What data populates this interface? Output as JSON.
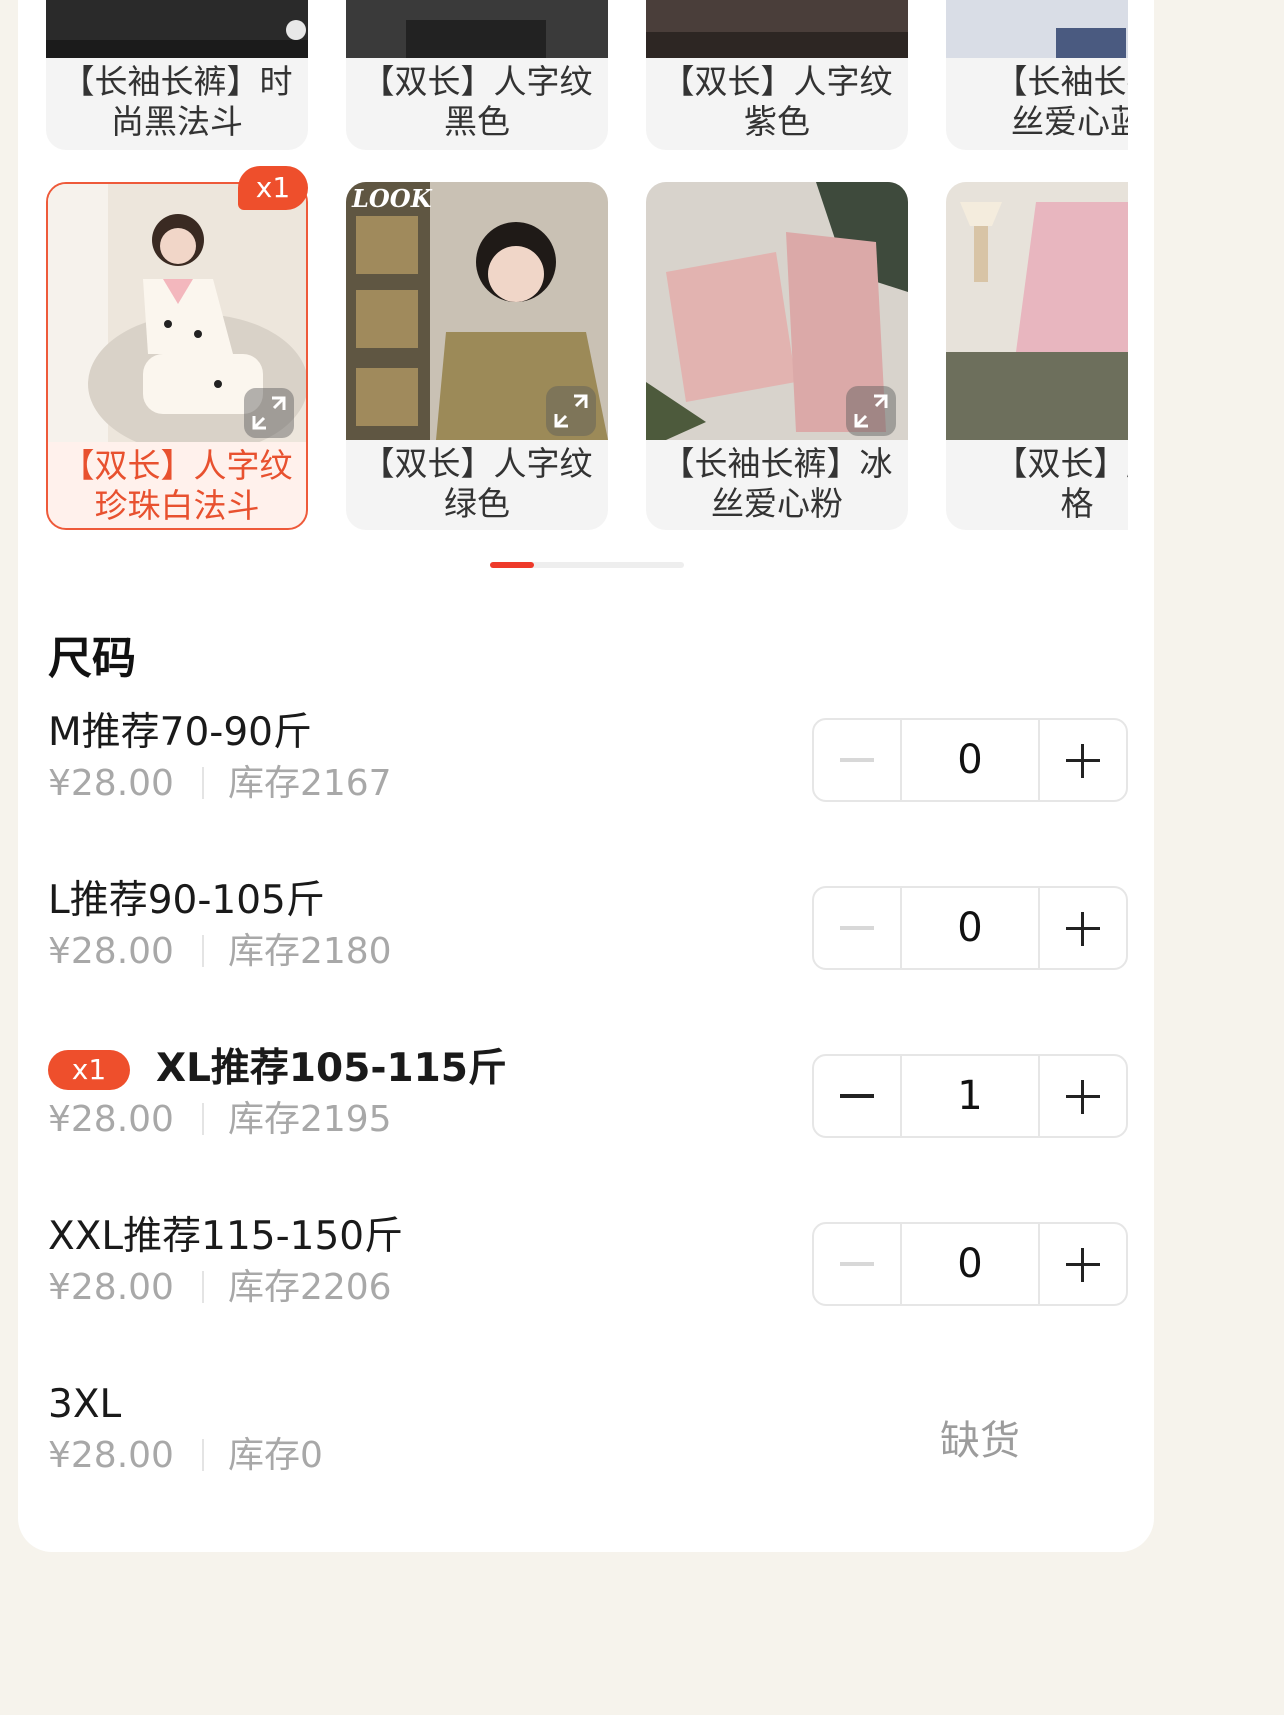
{
  "variants": {
    "row1": [
      {
        "label": "【长袖长裤】时\n尚黑法斗"
      },
      {
        "label": "【双长】人字纹\n黑色"
      },
      {
        "label": "【双长】人字纹\n紫色"
      },
      {
        "label": "【长袖长裤\n丝爱心蓝"
      }
    ],
    "row2": [
      {
        "label": "【双长】人字纹\n珍珠白法斗",
        "badge": "x1"
      },
      {
        "label": "【双长】人字纹\n绿色",
        "thumb_text": "LOOK"
      },
      {
        "label": "【长袖长裤】冰\n丝爱心粉"
      },
      {
        "label": "【双长】胭\n格"
      }
    ]
  },
  "sizes": {
    "title": "尺码",
    "items": [
      {
        "name": "M推荐70-90斤",
        "price": "¥28.00",
        "stock": "库存2167",
        "qty": "0"
      },
      {
        "name": "L推荐90-105斤",
        "price": "¥28.00",
        "stock": "库存2180",
        "qty": "0"
      },
      {
        "name": "XL推荐105-115斤",
        "price": "¥28.00",
        "stock": "库存2195",
        "qty": "1",
        "badge": "x1"
      },
      {
        "name": "XXL推荐115-150斤",
        "price": "¥28.00",
        "stock": "库存2206",
        "qty": "0"
      },
      {
        "name": "3XL",
        "price": "¥28.00",
        "stock": "库存0",
        "status": "缺货"
      }
    ]
  },
  "colors": {
    "accent": "#ee4f2c",
    "pager_active": "#ee3a2a"
  }
}
